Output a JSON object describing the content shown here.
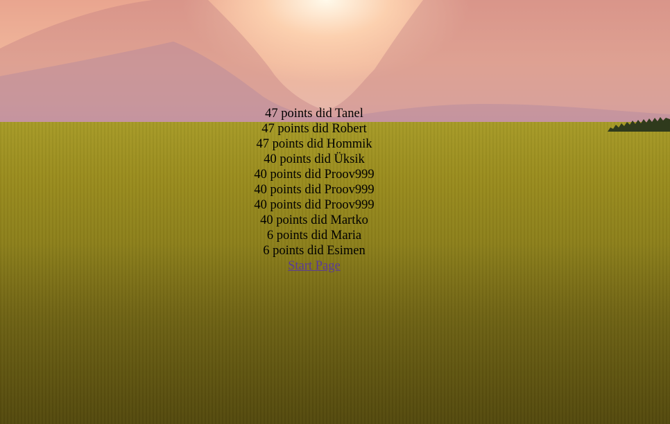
{
  "scores": [
    {
      "points": "47",
      "verb": "points did",
      "name": "Tanel"
    },
    {
      "points": "47",
      "verb": "points did",
      "name": "Robert"
    },
    {
      "points": "47",
      "verb": "points did",
      "name": "Hommik"
    },
    {
      "points": "40",
      "verb": "points did",
      "name": "Üksik"
    },
    {
      "points": "40",
      "verb": "points did",
      "name": "Proov999"
    },
    {
      "points": "40",
      "verb": "points did",
      "name": "Proov999"
    },
    {
      "points": "40",
      "verb": "points did",
      "name": "Proov999"
    },
    {
      "points": "40",
      "verb": "points did",
      "name": "Martko"
    },
    {
      "points": "6",
      "verb": "points did",
      "name": "Maria"
    },
    {
      "points": "6",
      "verb": "points did",
      "name": "Esimen"
    }
  ],
  "start_link": "Start Page",
  "colors": {
    "link": "#5a3a9a",
    "text": "#000000"
  }
}
